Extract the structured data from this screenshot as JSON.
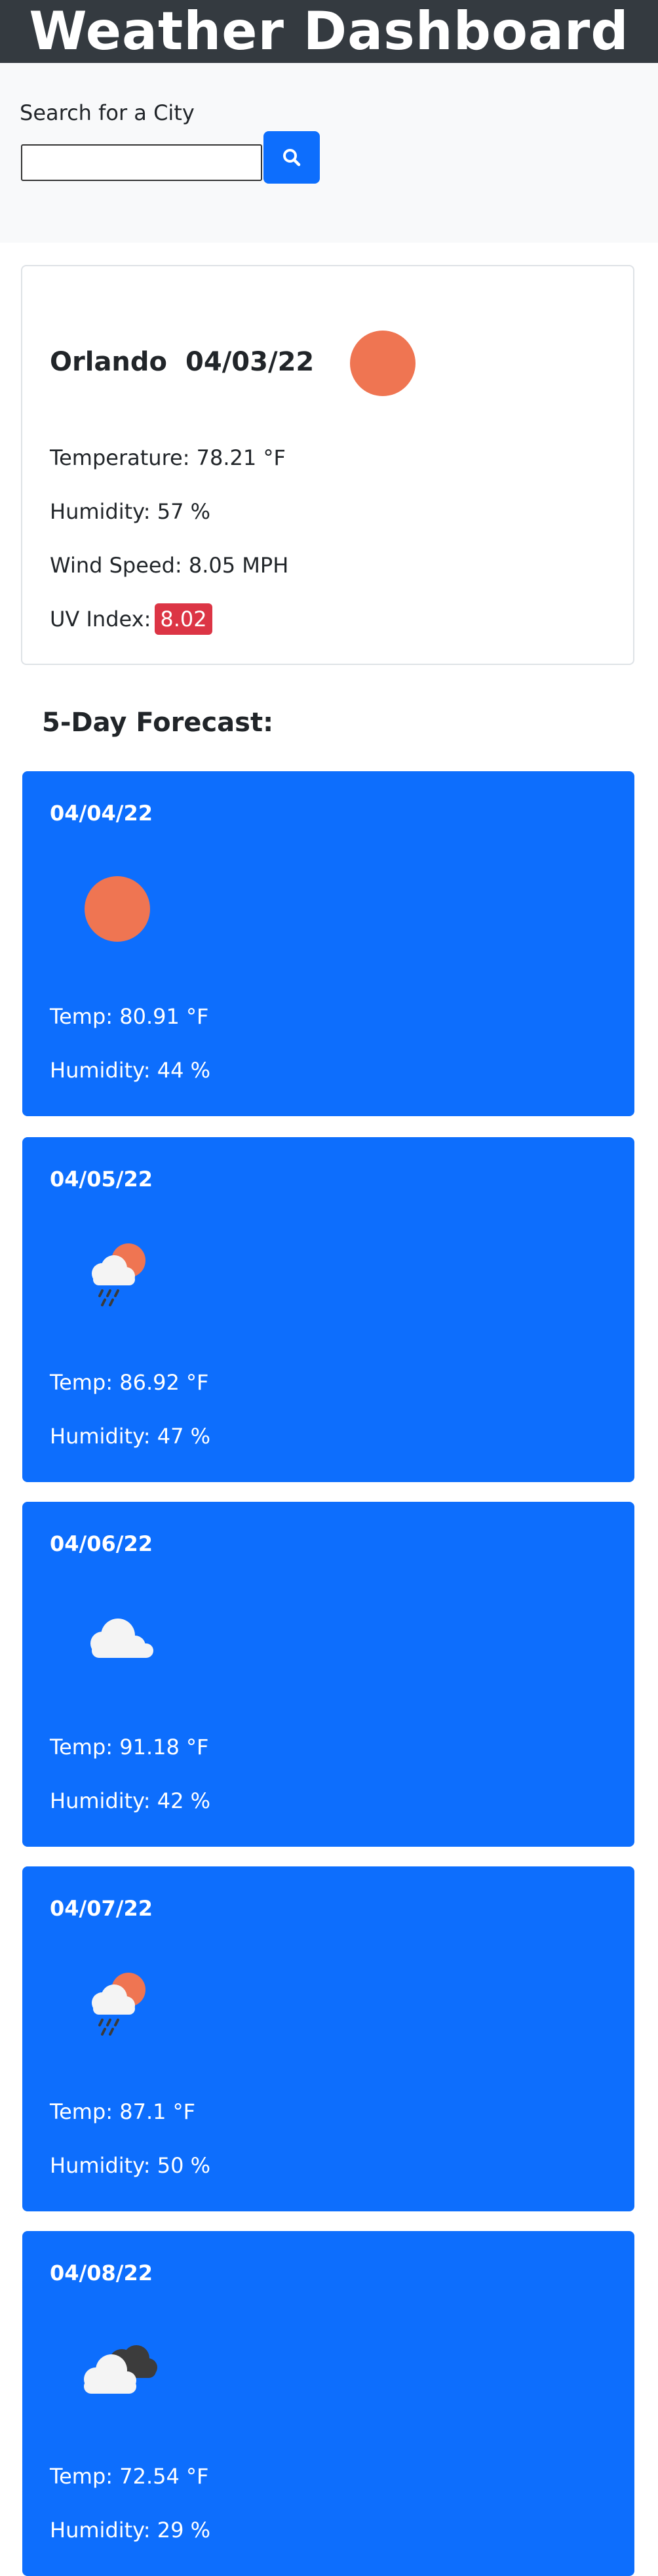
{
  "header": {
    "title": "Weather Dashboard"
  },
  "search": {
    "label": "Search for a City",
    "value": "",
    "placeholder": "",
    "button_icon": "search-icon"
  },
  "current": {
    "city": "Orlando",
    "date": "04/03/22",
    "icon": "sun-icon",
    "temperature": "Temperature: 78.21 °F",
    "humidity": "Humidity: 57 %",
    "wind": "Wind Speed: 8.05 MPH",
    "uv_label": "UV Index:",
    "uv_value": "8.02"
  },
  "forecast": {
    "heading": "5-Day Forecast:",
    "days": [
      {
        "date": "04/04/22",
        "icon": "sun-icon",
        "temp": "Temp: 80.91 °F",
        "humidity": "Humidity: 44 %"
      },
      {
        "date": "04/05/22",
        "icon": "sun-cloud-rain-icon",
        "temp": "Temp: 86.92 °F",
        "humidity": "Humidity: 47 %"
      },
      {
        "date": "04/06/22",
        "icon": "cloud-icon",
        "temp": "Temp: 91.18 °F",
        "humidity": "Humidity: 42 %"
      },
      {
        "date": "04/07/22",
        "icon": "sun-cloud-rain-icon",
        "temp": "Temp: 87.1 °F",
        "humidity": "Humidity: 50 %"
      },
      {
        "date": "04/08/22",
        "icon": "broken-clouds-icon",
        "temp": "Temp: 72.54 °F",
        "humidity": "Humidity: 29 %"
      }
    ]
  },
  "colors": {
    "header_bg": "#343a40",
    "primary": "#0d6efd",
    "uv_danger": "#dc3545",
    "sun": "#ef7552"
  }
}
